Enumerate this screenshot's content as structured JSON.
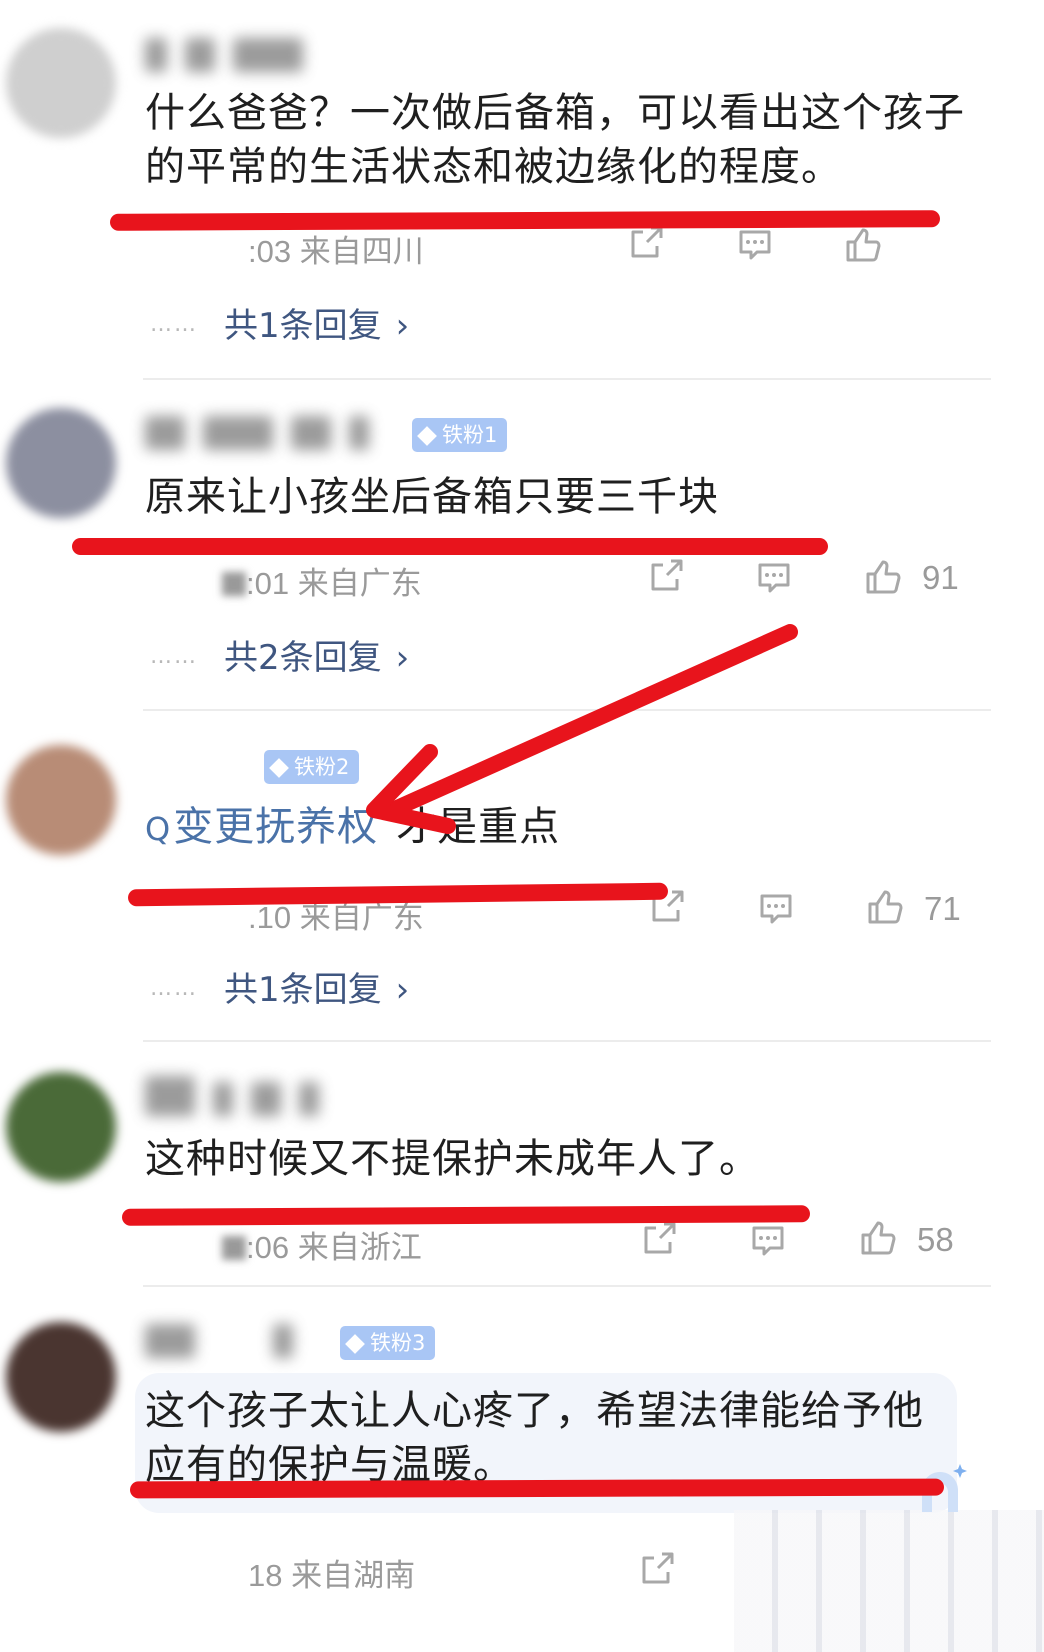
{
  "comments": [
    {
      "text": "什么爸爸？一次做后备箱，可以看出这个孩子的平常的生活状态和被边缘化的程度。",
      "meta": ":03 来自四川",
      "replies": "共1条回复",
      "avatar_color": "#cfcfcf"
    },
    {
      "badge": "铁粉1",
      "text": "原来让小孩坐后备箱只要三千块",
      "meta": ":01 来自广东",
      "likes": "91",
      "replies": "共2条回复",
      "avatar_color": "#8c8fa0"
    },
    {
      "badge": "铁粉2",
      "topic": "变更抚养权",
      "text_after_topic": "才是重点",
      "meta": ".10 来自广东",
      "likes": "71",
      "replies": "共1条回复",
      "avatar_color": "#b88c76"
    },
    {
      "text": "这种时候又不提保护未成年人了。",
      "meta": ":06 来自浙江",
      "likes": "58",
      "avatar_color": "#4a6a38"
    },
    {
      "badge": "铁粉3",
      "text": "这个孩子太让人心疼了，希望法律能给予他应有的保护与温暖。",
      "meta": "18 来自湖南",
      "avatar_color": "#4a3530"
    }
  ],
  "colors": {
    "annotation_red": "#e8141c",
    "link_blue": "#3f5680",
    "badge_blue": "#a9c6f5",
    "meta_gray": "#9a9a9a"
  },
  "icons": [
    "share-icon",
    "comment-icon",
    "like-icon",
    "chevron-right-icon",
    "search-icon",
    "diamond-icon"
  ]
}
